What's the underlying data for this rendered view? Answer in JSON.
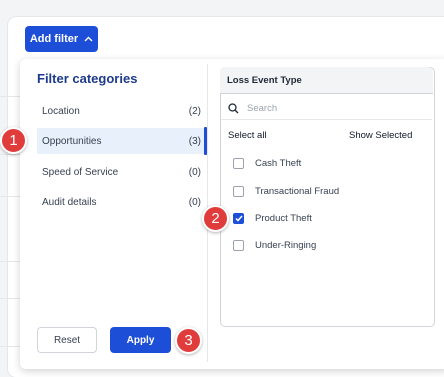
{
  "toolbar": {
    "add_filter_label": "Add filter"
  },
  "categories": {
    "title": "Filter categories",
    "items": [
      {
        "label": "Location",
        "count": "(2)"
      },
      {
        "label": "Opportunities",
        "count": "(3)"
      },
      {
        "label": "Speed of Service",
        "count": "(0)"
      },
      {
        "label": "Audit details",
        "count": "(0)"
      }
    ]
  },
  "loss_event": {
    "header": "Loss Event Type",
    "search_placeholder": "Search",
    "select_all": "Select all",
    "show_selected": "Show Selected",
    "options": [
      {
        "label": "Cash Theft",
        "checked": false
      },
      {
        "label": "Transactional Fraud",
        "checked": false
      },
      {
        "label": "Product Theft",
        "checked": true
      },
      {
        "label": "Under-Ringing",
        "checked": false
      }
    ]
  },
  "actions": {
    "reset_label": "Reset",
    "apply_label": "Apply"
  },
  "markers": [
    "1",
    "2",
    "3"
  ],
  "colors": {
    "accent": "#1d4ed8",
    "marker": "#e03c3c",
    "active_row": "#e8f0fb",
    "title": "#1e3a8a"
  }
}
